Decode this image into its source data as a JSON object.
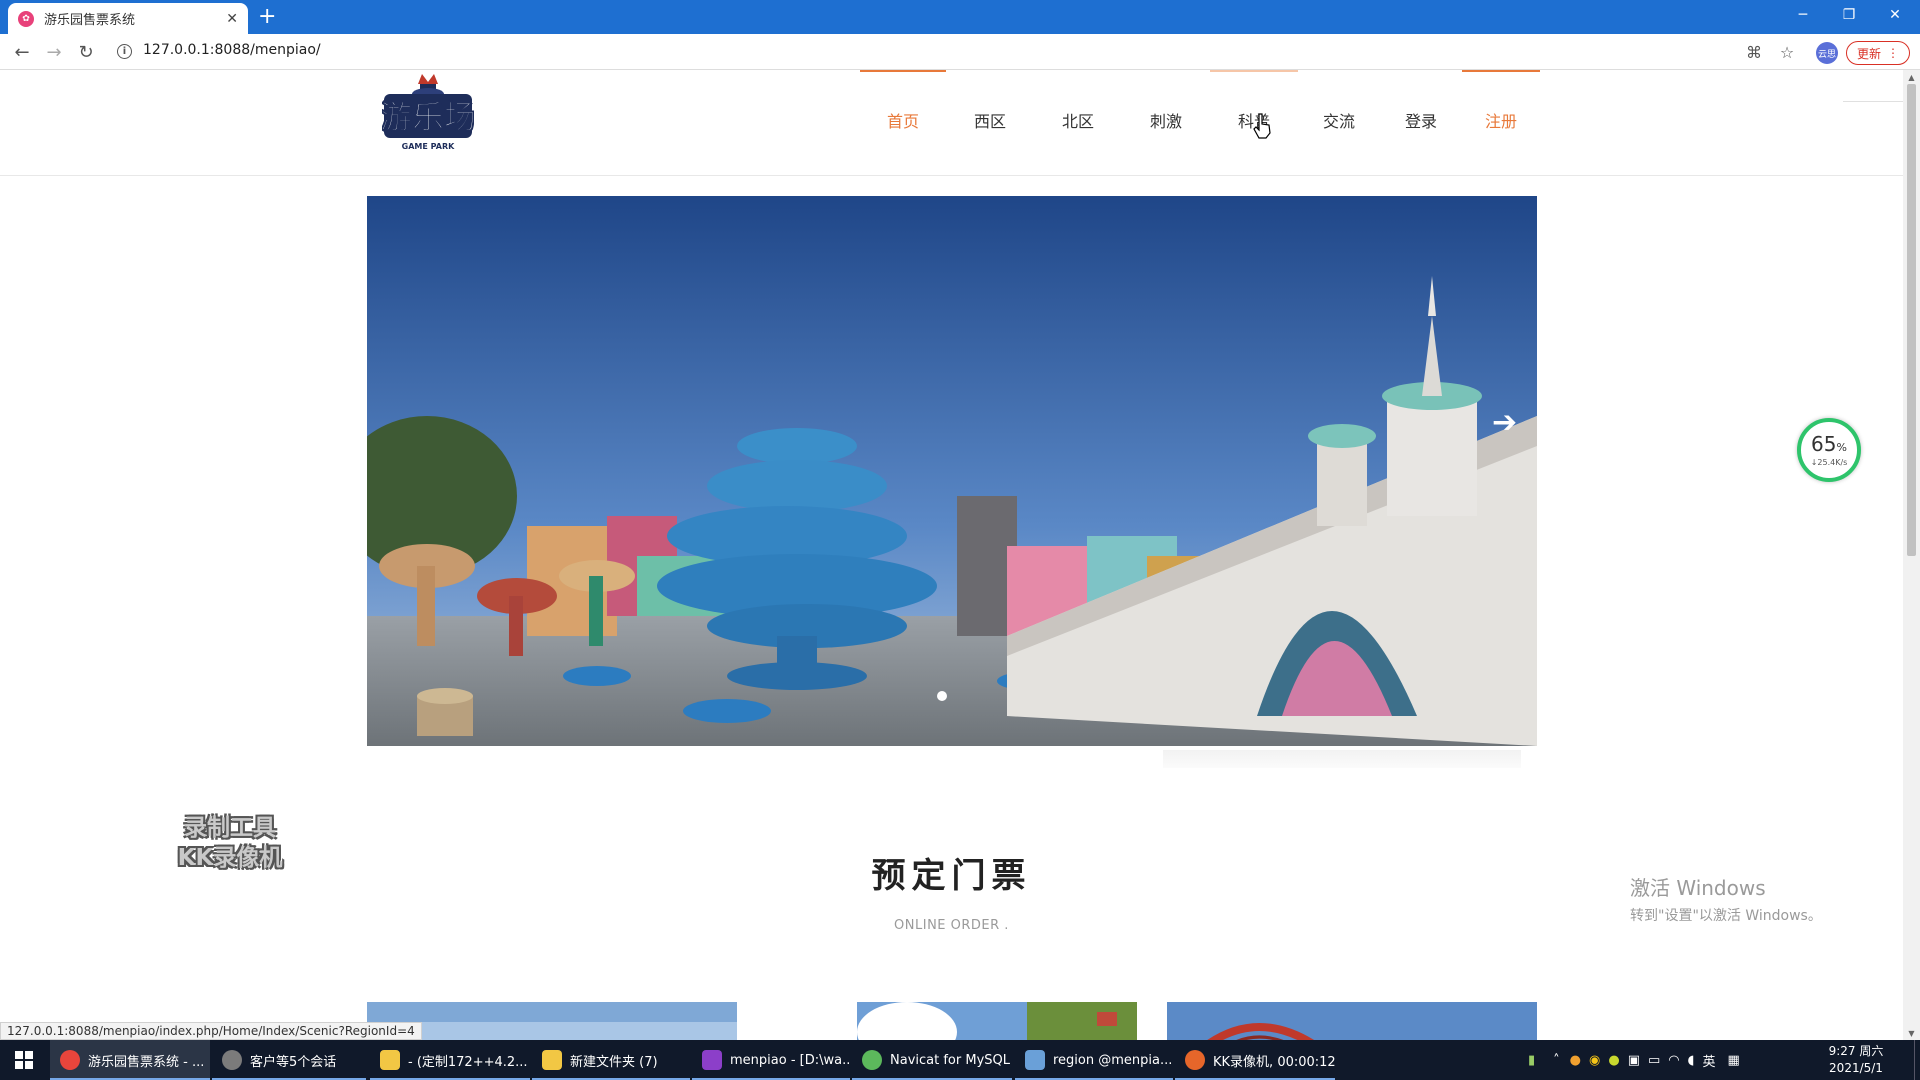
{
  "browser": {
    "tab_title": "游乐园售票系统",
    "tab_favicon": "ticket-favicon",
    "url": "127.0.0.1:8088/menpiao/",
    "update_label": "更新",
    "profile_label": "云思"
  },
  "site": {
    "logo_text": "游乐场",
    "logo_sub": "GAME PARK",
    "nav": [
      {
        "label": "首页",
        "active": true
      },
      {
        "label": "西区"
      },
      {
        "label": "北区"
      },
      {
        "label": "刺激"
      },
      {
        "label": "科普"
      },
      {
        "label": "交流"
      },
      {
        "label": "登录"
      },
      {
        "label": "注册"
      }
    ],
    "carousel": {
      "slide_count": 1,
      "active_slide": 1,
      "next_icon": "arrow-right-icon"
    },
    "section": {
      "title": "预定门票",
      "subtitle": "ONLINE ORDER ."
    },
    "status_url": "127.0.0.1:8088/menpiao/index.php/Home/Index/Scenic?RegionId=4"
  },
  "overlays": {
    "record_watermark": [
      "录制工具",
      "KK录像机"
    ],
    "activate_title": "激活 Windows",
    "activate_sub": "转到\"设置\"以激活 Windows。",
    "speed_percent": "65",
    "speed_unit": "%",
    "speed_rate": "↓25.4K/s"
  },
  "taskbar": {
    "items": [
      {
        "label": "游乐园售票系统 - ...",
        "icon": "chrome-icon",
        "color": "#e8453c"
      },
      {
        "label": "客户等5个会话",
        "icon": "chat-avatar-icon",
        "color": "#7b7b7b"
      },
      {
        "label": "- (定制172++4.2...",
        "icon": "folder-icon",
        "color": "#f2c744"
      },
      {
        "label": "新建文件夹 (7)",
        "icon": "folder-icon",
        "color": "#f2c744"
      },
      {
        "label": "menpiao - [D:\\wa...",
        "icon": "phpstorm-icon",
        "color": "#8c3fc9"
      },
      {
        "label": "Navicat for MySQL",
        "icon": "navicat-icon",
        "color": "#5cb85c"
      },
      {
        "label": "region @menpia...",
        "icon": "table-icon",
        "color": "#6aa0d8"
      },
      {
        "label": "KK录像机, 00:00:12",
        "icon": "kk-recorder-icon",
        "color": "#e6662a"
      }
    ],
    "ime": "英",
    "time": "9:27 周六",
    "date": "2021/5/1"
  }
}
